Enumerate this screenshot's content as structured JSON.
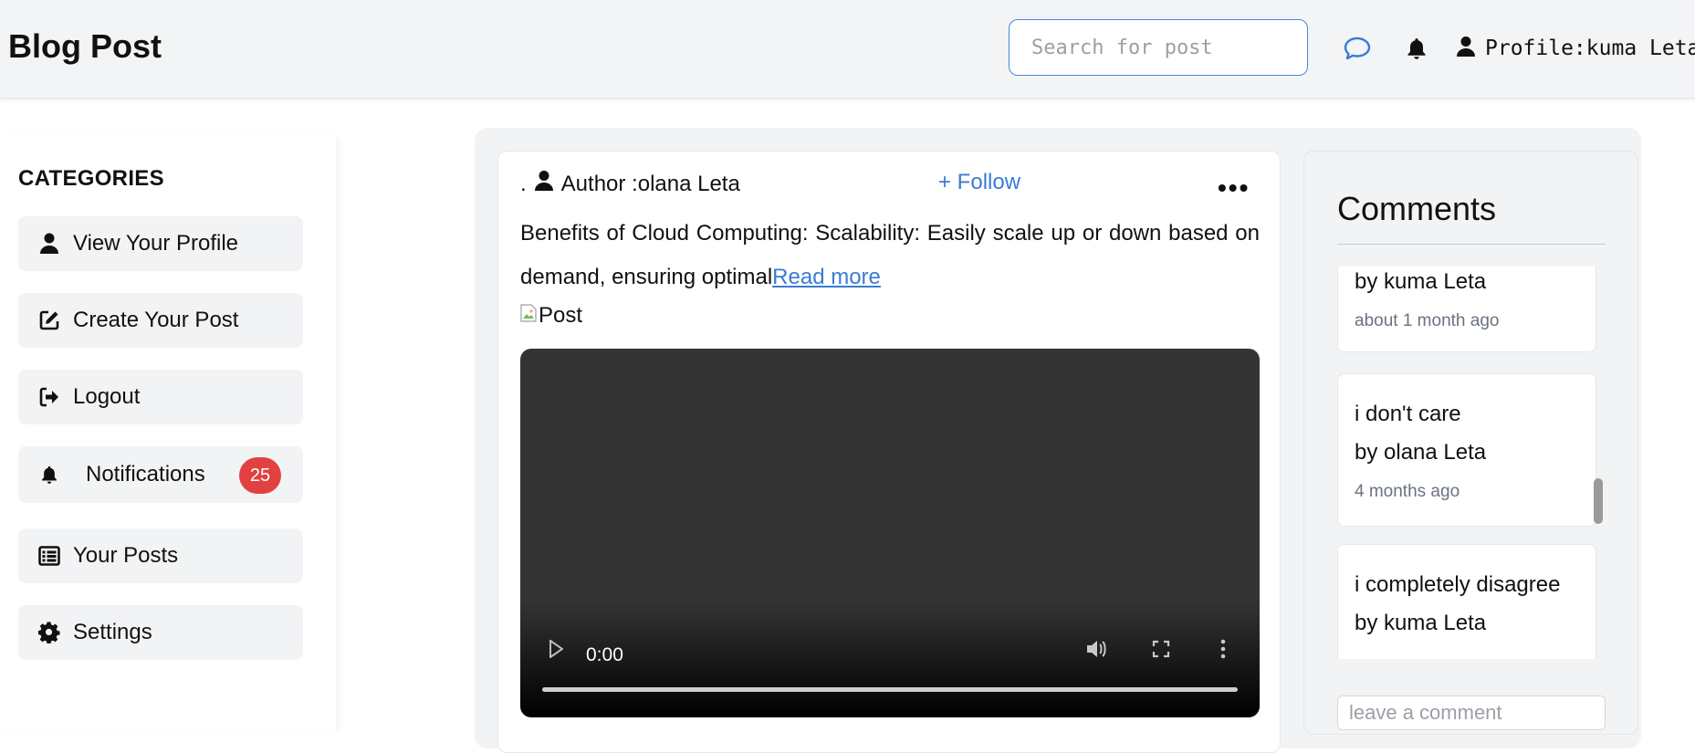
{
  "header": {
    "brand": "Blog Post",
    "search_placeholder": "Search for post",
    "profile_label": "Profile:kuma Leta"
  },
  "sidebar": {
    "title": "CATEGORIES",
    "items": [
      {
        "label": "View Your Profile",
        "icon": "user-icon"
      },
      {
        "label": "Create Your Post",
        "icon": "edit-icon"
      },
      {
        "label": "Logout",
        "icon": "logout-icon"
      },
      {
        "label": "Notifications",
        "icon": "bell-icon",
        "badge": "25"
      },
      {
        "label": "Your Posts",
        "icon": "list-icon"
      },
      {
        "label": "Settings",
        "icon": "gear-icon"
      }
    ]
  },
  "post": {
    "prefix": ".",
    "author": "Author :olana Leta",
    "follow_label": "+ Follow",
    "more_label": "•••",
    "body": "Benefits of Cloud Computing: Scalability: Easily scale up or down based on demand, ensuring optimal",
    "read_more": "Read more",
    "image_alt": "Post",
    "video_time": "0:00"
  },
  "comments": {
    "title": "Comments",
    "items": [
      {
        "text": "",
        "author": "by kuma Leta",
        "time": "about 1 month ago"
      },
      {
        "text": "i don't care",
        "author": "by olana Leta",
        "time": "4 months ago"
      },
      {
        "text": "i completely disagree",
        "author": "by kuma Leta",
        "time": ""
      }
    ],
    "input_placeholder": "leave a comment"
  },
  "colors": {
    "accent": "#3a7bd5",
    "badge": "#e24141",
    "panel_bg": "#f2f3f5"
  }
}
